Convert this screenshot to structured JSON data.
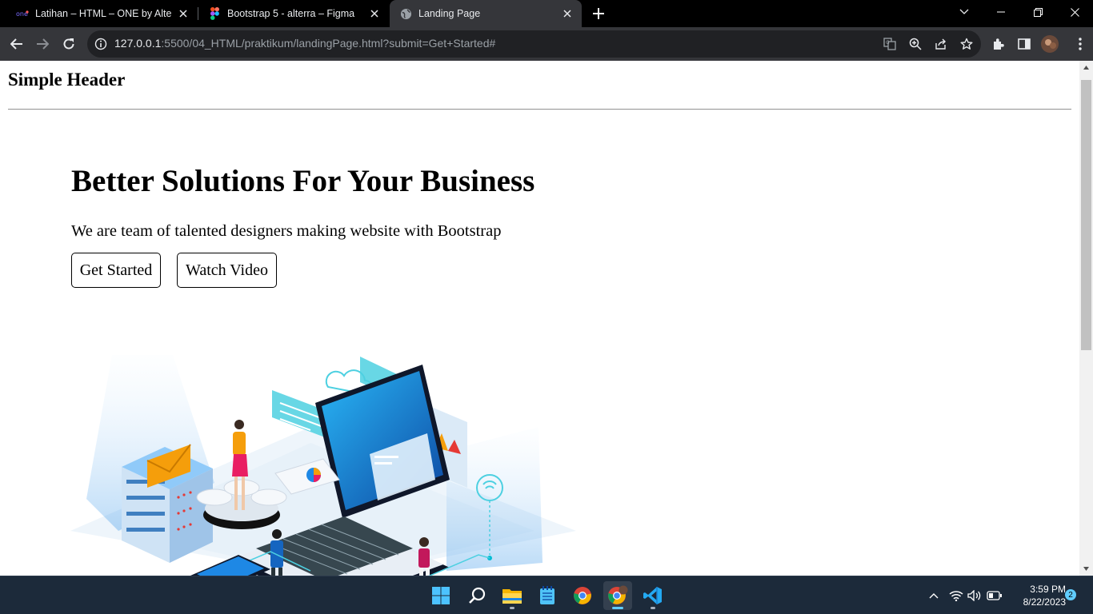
{
  "browser": {
    "tabs": [
      {
        "title": "Latihan – HTML – ONE by Alterra",
        "favicon": "alterra-icon",
        "active": false
      },
      {
        "title": "Bootstrap 5 - alterra – Figma",
        "favicon": "figma-icon",
        "active": false
      },
      {
        "title": "Landing Page",
        "favicon": "globe-icon",
        "active": true
      }
    ],
    "address": {
      "host": "127.0.0.1",
      "rest": ":5500/04_HTML/praktikum/landingPage.html?submit=Get+Started#"
    }
  },
  "page": {
    "header": "Simple Header",
    "hero": {
      "title": "Better Solutions For Your Business",
      "subtitle": "We are team of talented designers making website with Bootstrap",
      "buttons": {
        "get_started": "Get Started",
        "watch_video": "Watch Video"
      },
      "illustration": "isometric-laptop-illustration"
    }
  },
  "taskbar": {
    "apps": [
      "windows-start-icon",
      "search-icon",
      "file-explorer-icon",
      "notepad-icon",
      "chrome-icon",
      "chrome-profile-icon",
      "vscode-icon"
    ],
    "clock": {
      "time": "3:59 PM",
      "date": "8/22/2023"
    },
    "notifications": "2"
  },
  "colors": {
    "accent": "#60cdff",
    "taskbar": "#1c2a3a",
    "toolbar": "#35363a"
  }
}
